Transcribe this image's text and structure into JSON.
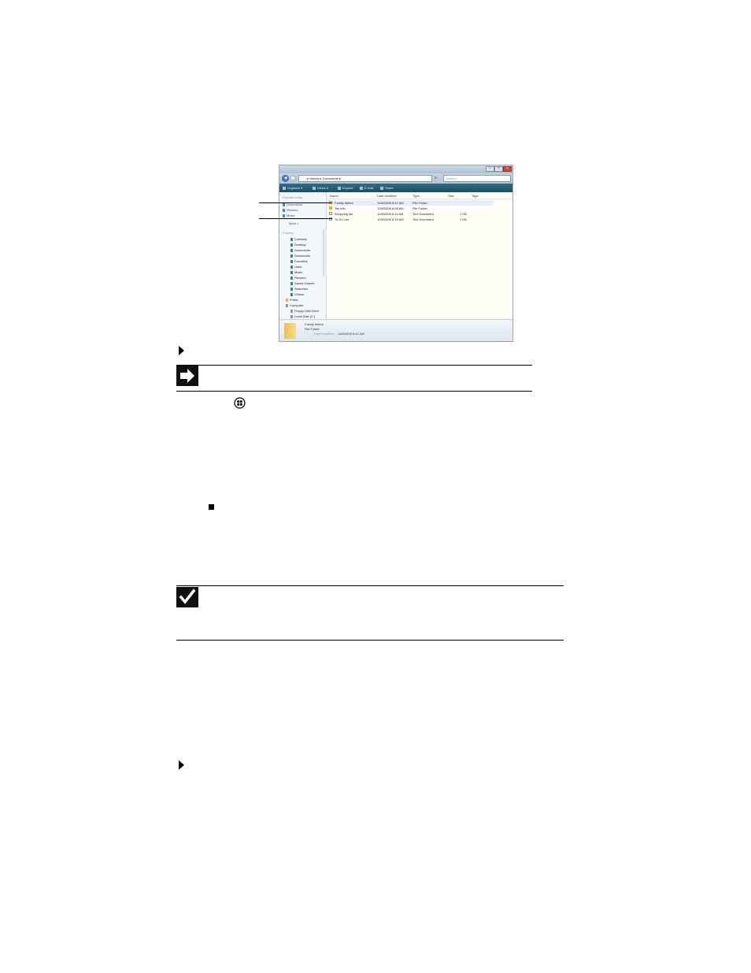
{
  "window": {
    "address": "▸ Wendy ▸ Documents ▸",
    "search_placeholder": "Search",
    "toolbar": [
      "Organize ▾",
      "Views ▾",
      "Explore",
      "E-mail",
      "Share"
    ],
    "nav_header": "Favorite Links",
    "favorite_links": [
      "Documents",
      "Pictures",
      "Music"
    ],
    "more_label": "More »",
    "folders_header": "Folders",
    "folders": [
      "Contacts",
      "Desktop",
      "Documents",
      "Downloads",
      "Favorites",
      "Links",
      "Music",
      "Pictures",
      "Saved Games",
      "Searches",
      "Videos",
      "Public",
      "Computer",
      "Floppy Disk Drive",
      "Local Disk (C:)"
    ],
    "columns": [
      "Name",
      "Date modified",
      "Type",
      "Size",
      "Tags"
    ],
    "files": [
      {
        "name": "Family letters",
        "date": "12/8/2006 8:42 AM",
        "type": "File Folder",
        "size": ""
      },
      {
        "name": "Tax info",
        "date": "12/8/2006 8:08 AM",
        "type": "File Folder",
        "size": ""
      },
      {
        "name": "Shopping list",
        "date": "12/8/2006 8:11 AM",
        "type": "Text Document",
        "size": "1 KB"
      },
      {
        "name": "To Do List",
        "date": "12/8/2006 8:15 AM",
        "type": "Text Document",
        "size": "1 KB"
      }
    ],
    "details": {
      "name": "Family letters",
      "type": "File Folder",
      "date_label": "Date modified:",
      "date_value": "12/8/2006 8:42 AM"
    }
  }
}
